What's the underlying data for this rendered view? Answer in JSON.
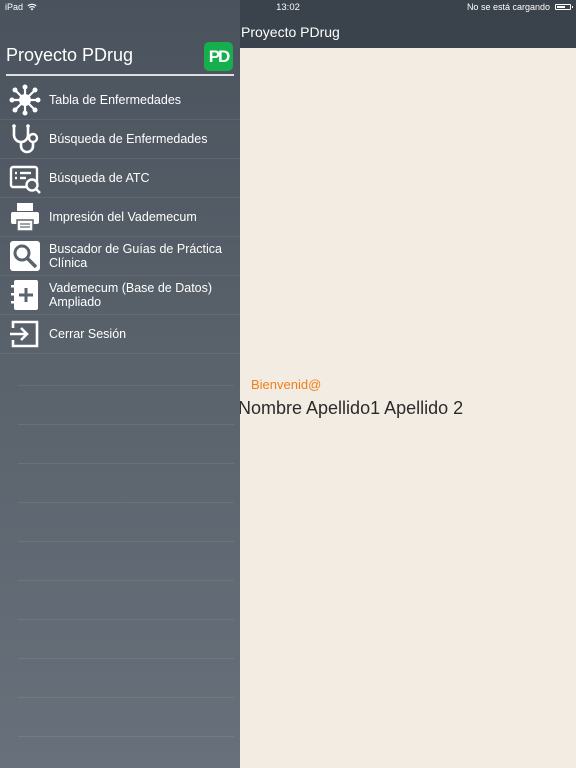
{
  "status_bar": {
    "device": "iPad",
    "time": "13:02",
    "charging": "No se está cargando"
  },
  "nav_bar": {
    "title": "Proyecto PDrug"
  },
  "drawer": {
    "title": "Proyecto PDrug",
    "logo_text": "PD",
    "logo_color": "#15b04d",
    "items": [
      {
        "label": "Tabla de Enfermedades",
        "icon": "virus-icon"
      },
      {
        "label": "Búsqueda de Enfermedades",
        "icon": "stethoscope-icon"
      },
      {
        "label": "Búsqueda de ATC",
        "icon": "card-search-icon"
      },
      {
        "label": "Impresión del Vademecum",
        "icon": "printer-icon"
      },
      {
        "label": "Buscador de Guías de Práctica Clínica",
        "icon": "magnifier-icon"
      },
      {
        "label": "Vademecum (Base de Datos) Ampliado",
        "icon": "notebook-plus-icon"
      },
      {
        "label": "Cerrar Sesión",
        "icon": "logout-icon"
      }
    ]
  },
  "main": {
    "welcome": "Bienvenid@",
    "user_name": "Nombre Apellido1 Apellido 2",
    "accent_color": "#ef7f1a"
  }
}
